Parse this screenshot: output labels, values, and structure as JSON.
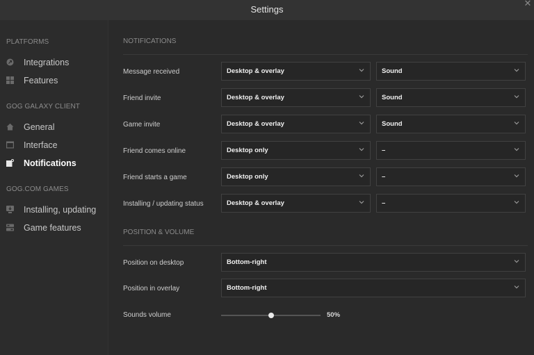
{
  "window": {
    "title": "Settings",
    "close_glyph": "✕"
  },
  "sidebar": {
    "sections": [
      {
        "header": "PLATFORMS",
        "items": [
          {
            "label": "Integrations",
            "icon": "integrations-icon"
          },
          {
            "label": "Features",
            "icon": "features-grid-icon"
          }
        ]
      },
      {
        "header": "GOG GALAXY CLIENT",
        "items": [
          {
            "label": "General",
            "icon": "home-icon"
          },
          {
            "label": "Interface",
            "icon": "interface-icon"
          },
          {
            "label": "Notifications",
            "icon": "notifications-icon",
            "active": true
          }
        ]
      },
      {
        "header": "GOG.COM GAMES",
        "items": [
          {
            "label": "Installing, updating",
            "icon": "download-icon"
          },
          {
            "label": "Game features",
            "icon": "game-features-icon"
          }
        ]
      }
    ]
  },
  "notifications": {
    "header": "NOTIFICATIONS",
    "rows": [
      {
        "label": "Message received",
        "display": "Desktop & overlay",
        "sound": "Sound"
      },
      {
        "label": "Friend invite",
        "display": "Desktop & overlay",
        "sound": "Sound"
      },
      {
        "label": "Game invite",
        "display": "Desktop & overlay",
        "sound": "Sound"
      },
      {
        "label": "Friend comes online",
        "display": "Desktop only",
        "sound": "–"
      },
      {
        "label": "Friend starts a game",
        "display": "Desktop only",
        "sound": "–"
      },
      {
        "label": "Installing / updating status",
        "display": "Desktop & overlay",
        "sound": "–"
      }
    ]
  },
  "position_volume": {
    "header": "POSITION & VOLUME",
    "desktop_label": "Position on desktop",
    "desktop_value": "Bottom-right",
    "overlay_label": "Position in overlay",
    "overlay_value": "Bottom-right",
    "volume_label": "Sounds volume",
    "volume_value": "50%",
    "volume_fraction": 0.5
  },
  "colors": {
    "background": "#2a2a2a",
    "titlebar": "#333333",
    "select_bg": "#262626",
    "select_border": "#414141",
    "text_muted": "#8c8c8c",
    "text_active": "#ffffff"
  }
}
